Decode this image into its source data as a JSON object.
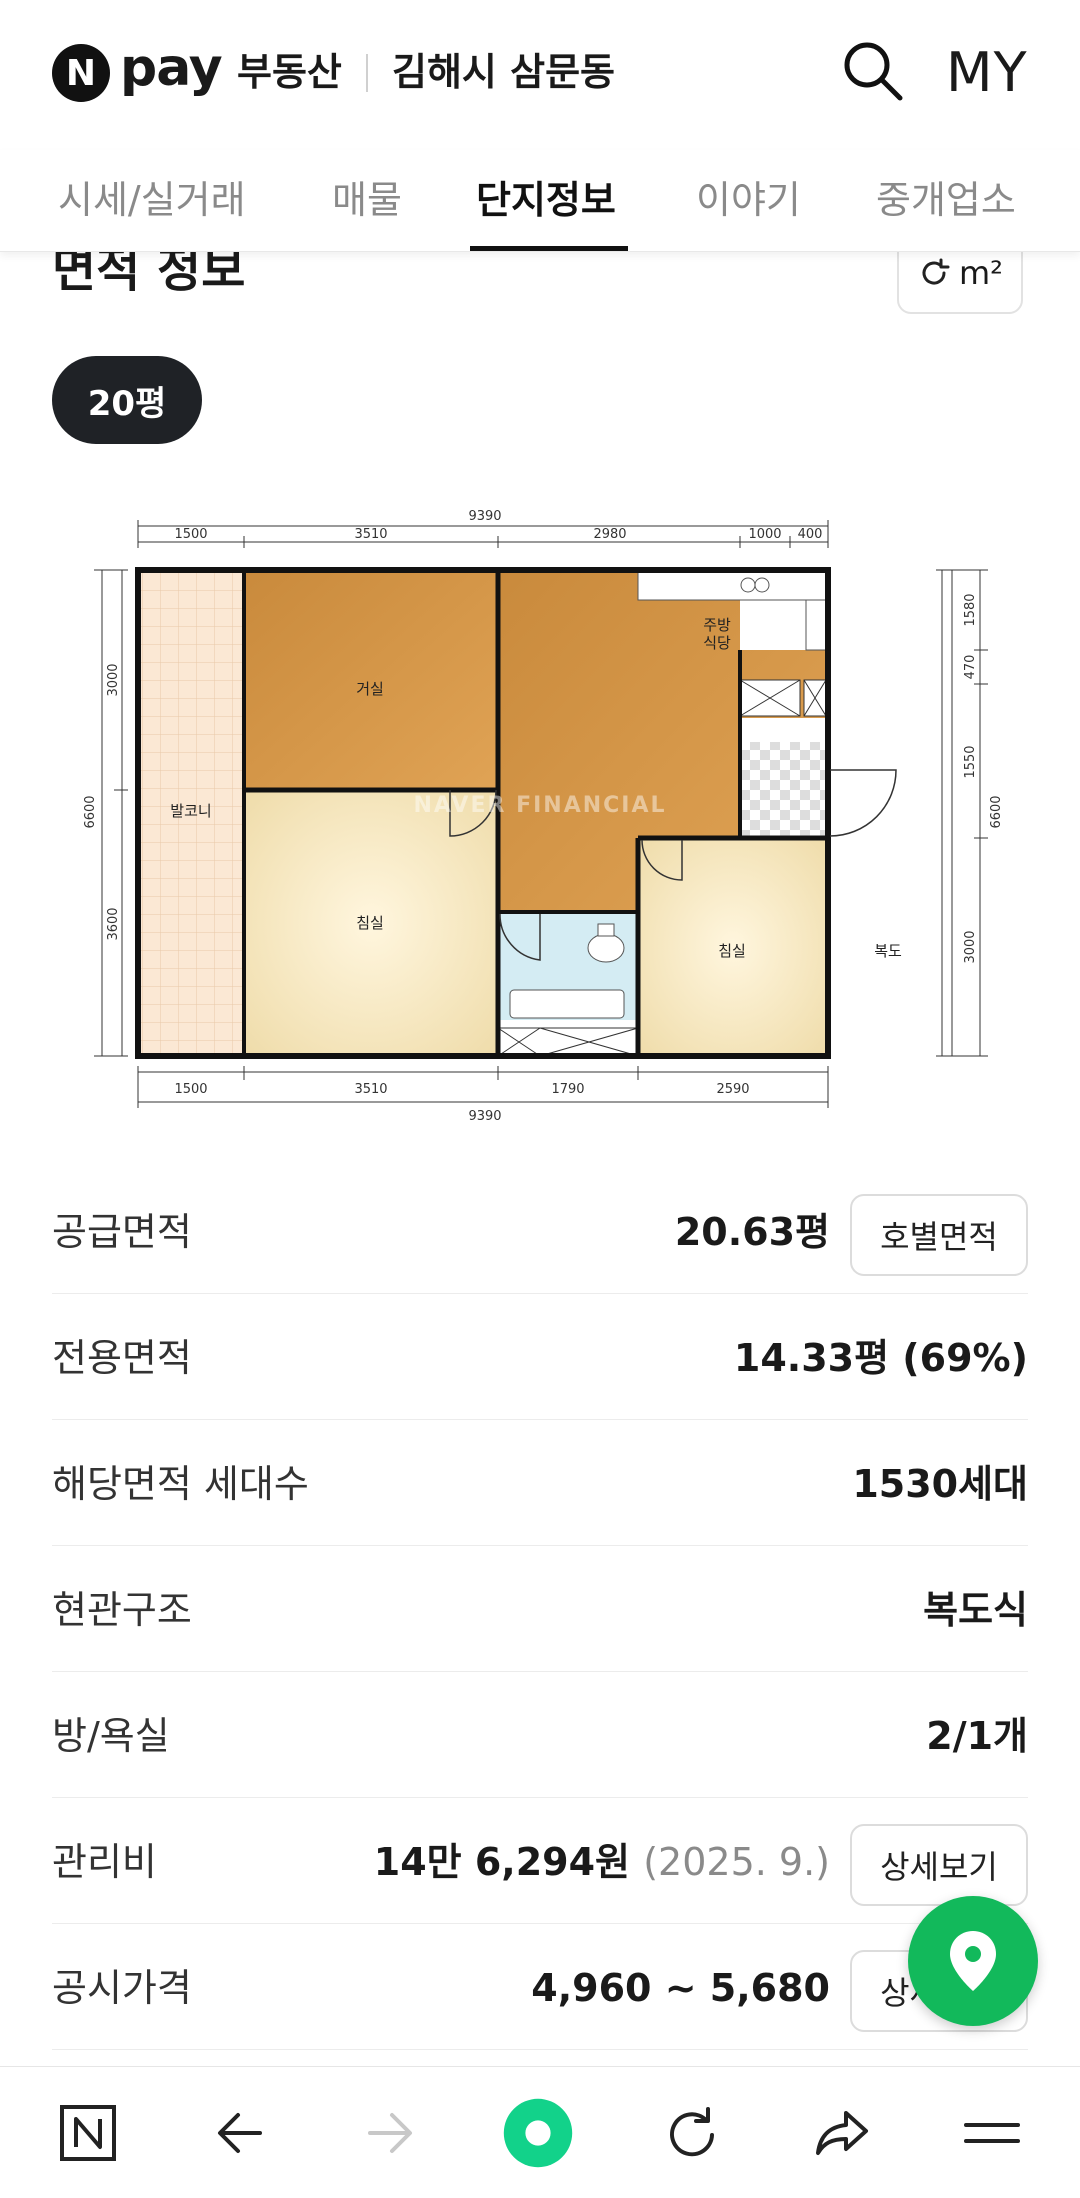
{
  "header": {
    "logo_letter": "N",
    "logo_word": "pay",
    "brand": "부동산",
    "location": "김해시 삼문동",
    "my_label": "MY"
  },
  "tabs": [
    {
      "label": "시세/실거래",
      "active": false
    },
    {
      "label": "매물",
      "active": false
    },
    {
      "label": "단지정보",
      "active": true
    },
    {
      "label": "이야기",
      "active": false
    },
    {
      "label": "중개업소",
      "active": false
    }
  ],
  "section": {
    "title": "면적 정보",
    "unit_toggle": "m²",
    "size_chip": "20평"
  },
  "floorplan": {
    "watermark": "NAVER FINANCIAL",
    "rooms": {
      "living": "거실",
      "kitchen": "주방\n식당",
      "balcony": "발코니",
      "bedroom1": "침실",
      "bedroom2": "침실",
      "corridor": "복도"
    },
    "dims_top": [
      "1500",
      "3510",
      "2980",
      "1000",
      "400"
    ],
    "dims_total": "9390",
    "dims_bottom": [
      "1500",
      "3510",
      "1790",
      "2590"
    ],
    "dims_left": [
      "3000",
      "3600"
    ],
    "dims_left_total": "6600",
    "dims_right": [
      "1580",
      "470",
      "1550",
      "3000"
    ],
    "dims_right_total": "6600"
  },
  "info": {
    "supply": {
      "label": "공급면적",
      "value": "20.63평",
      "button": "호별면적"
    },
    "exclusive": {
      "label": "전용면적",
      "value": "14.33평 (69%)"
    },
    "households": {
      "label": "해당면적 세대수",
      "value": "1530세대"
    },
    "entrance": {
      "label": "현관구조",
      "value": "복도식"
    },
    "rooms": {
      "label": "방/욕실",
      "value": "2/1개"
    },
    "fee": {
      "label": "관리비",
      "value": "14만 6,294원",
      "date": "(2025. 9.)",
      "button": "상세보기"
    },
    "price": {
      "label": "공시가격",
      "value": "4,960 ~ 5,680",
      "button": "상세보기"
    }
  },
  "colors": {
    "accent_green": "#12b95b",
    "chip_dark": "#1f2226"
  }
}
